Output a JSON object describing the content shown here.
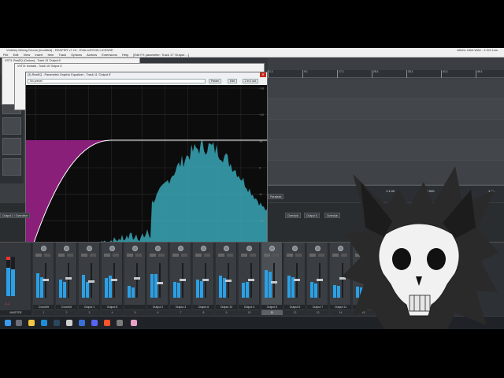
{
  "window": {
    "title": "Vodeley Mixing Drums [modified] - REAPER v7.19 - EVALUATION LICENSE",
    "status_right": "[Edit FX parameter: Track 17 'Output ...]",
    "status_far_right": "48kHz 24bit WAV : 4.2/2.1ms"
  },
  "menu": {
    "items": [
      "File",
      "Edit",
      "View",
      "Insert",
      "Item",
      "Track",
      "Options",
      "Actions",
      "Extensions",
      "Help"
    ]
  },
  "ruler": {
    "marks": [
      {
        "bar": "1.1",
        "time": "0:00.000"
      },
      {
        "bar": "9.1",
        "time": "0:16.000"
      },
      {
        "bar": "17.1",
        "time": "0:32.000"
      },
      {
        "bar": "25.1",
        "time": "0:48.000"
      },
      {
        "bar": "33.1",
        "time": "1:04.000"
      },
      {
        "bar": "41.1",
        "time": "1:20.000"
      },
      {
        "bar": "49.1",
        "time": "1:36.000"
      }
    ]
  },
  "transport": {
    "position": "1:1.00",
    "time": "0:00.000",
    "rate": "1.00"
  },
  "windows": {
    "bg1_title": "VST3: ReaEQ (Cockos) - Track 13 'Output 6'",
    "bg2_title": "VST3i: Kontakt - Track 15 'Output 4'",
    "eq_title": "(3) ReaEQ - Parametric Graphic Equalizer - Track 11 'Output 5'",
    "preset": "No preset",
    "param_btn": "Param",
    "edit_btn": "Edit",
    "io_btn": "2 in 2 out"
  },
  "eq": {
    "db_labels": [
      "+18",
      "+12",
      "+6",
      "0",
      "-6",
      "-12",
      "-18"
    ],
    "freq_labels": [
      "20",
      "50",
      "100",
      "200",
      "500",
      "1k",
      "2k",
      "5k",
      "10k"
    ]
  },
  "tracks_right": {
    "labels": [
      "Output 1 / Overdrive",
      "FX",
      "Paralead",
      "FX",
      "Overdub",
      "FX",
      "Output 5",
      "FX",
      "Overdub",
      "FX",
      "Output 7"
    ]
  },
  "mixer": {
    "master_label": "MASTER",
    "master_value": "-0.2",
    "strips": [
      {
        "name": "DrumKit",
        "num": "1",
        "selected": false,
        "l": 0.62,
        "r": 0.52,
        "fader": 0.55
      },
      {
        "name": "DrumKit",
        "num": "2",
        "selected": false,
        "l": 0.45,
        "r": 0.4,
        "fader": 0.6
      },
      {
        "name": "Output 1",
        "num": "3",
        "selected": false,
        "l": 0.58,
        "r": 0.4,
        "fader": 0.5
      },
      {
        "name": "Output 8",
        "num": "4",
        "selected": false,
        "l": 0.5,
        "r": 0.55,
        "fader": 0.55
      },
      {
        "name": "",
        "num": "5",
        "selected": false,
        "l": 0.3,
        "r": 0.25,
        "fader": 0.58
      },
      {
        "name": "Output 2",
        "num": "6",
        "selected": false,
        "l": 0.6,
        "r": 0.6,
        "fader": 0.45
      },
      {
        "name": "Output 3",
        "num": "7",
        "selected": false,
        "l": 0.4,
        "r": 0.38,
        "fader": 0.55
      },
      {
        "name": "Output 6",
        "num": "8",
        "selected": false,
        "l": 0.45,
        "r": 0.42,
        "fader": 0.55
      },
      {
        "name": "Output 10",
        "num": "9",
        "selected": false,
        "l": 0.55,
        "r": 0.5,
        "fader": 0.52
      },
      {
        "name": "Output 4",
        "num": "10",
        "selected": false,
        "l": 0.38,
        "r": 0.4,
        "fader": 0.55
      },
      {
        "name": "Output 5",
        "num": "11",
        "selected": true,
        "l": 0.7,
        "r": 0.66,
        "fader": 0.48
      },
      {
        "name": "Output 6",
        "num": "12",
        "selected": false,
        "l": 0.55,
        "r": 0.52,
        "fader": 0.55
      },
      {
        "name": "Output 7",
        "num": "13",
        "selected": false,
        "l": 0.4,
        "r": 0.36,
        "fader": 0.55
      },
      {
        "name": "Output 11",
        "num": "14",
        "selected": false,
        "l": 0.32,
        "r": 0.3,
        "fader": 0.58
      },
      {
        "name": "Output 12",
        "num": "15",
        "selected": false,
        "l": 0.28,
        "r": 0.25,
        "fader": 0.56
      }
    ]
  },
  "colors": {
    "eq_fill": "#8a1f7a",
    "spectrum": "#3aa8b8",
    "meter": "#2aa0e6",
    "close": "#c42b1c"
  },
  "taskbar": {
    "icons": [
      "windows-icon",
      "search-icon",
      "explorer-icon",
      "edge-icon",
      "steam-icon",
      "reaper-icon",
      "store-icon",
      "discord-icon",
      "brave-icon",
      "obs-icon",
      "app-icon"
    ]
  }
}
